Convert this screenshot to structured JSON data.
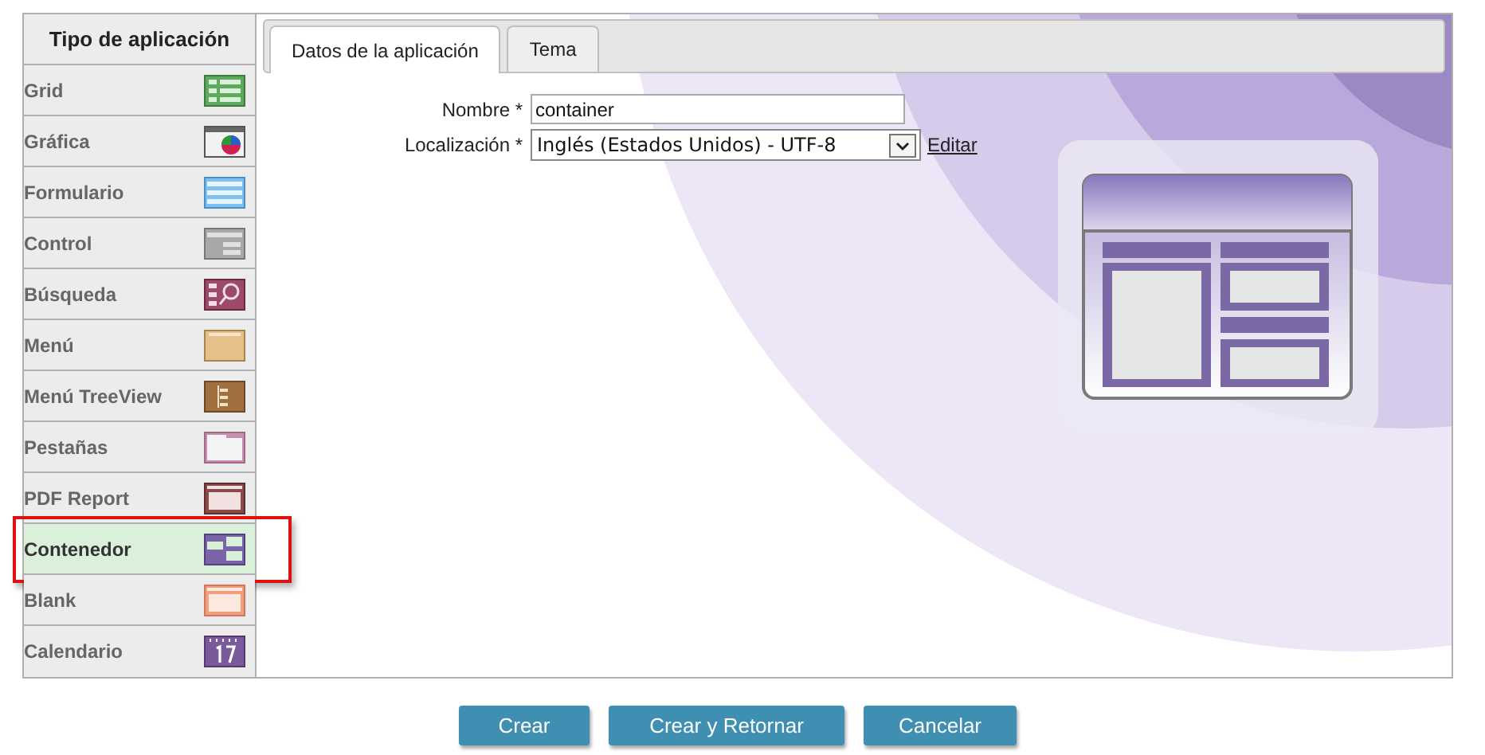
{
  "sidebar": {
    "title": "Tipo de aplicación",
    "items": [
      {
        "label": "Grid",
        "selected": false
      },
      {
        "label": "Gráfica",
        "selected": false
      },
      {
        "label": "Formulario",
        "selected": false
      },
      {
        "label": "Control",
        "selected": false
      },
      {
        "label": "Búsqueda",
        "selected": false
      },
      {
        "label": "Menú",
        "selected": false
      },
      {
        "label": "Menú TreeView",
        "selected": false
      },
      {
        "label": "Pestañas",
        "selected": false
      },
      {
        "label": "PDF Report",
        "selected": false
      },
      {
        "label": "Contenedor",
        "selected": true
      },
      {
        "label": "Blank",
        "selected": false
      },
      {
        "label": "Calendario",
        "selected": false
      }
    ]
  },
  "tabs": [
    {
      "label": "Datos de la aplicación",
      "selected": true
    },
    {
      "label": "Tema",
      "selected": false
    }
  ],
  "form": {
    "name": {
      "label": "Nombre *",
      "value": "container"
    },
    "locale": {
      "label": "Localización *",
      "value": "Inglés (Estados Unidos) - UTF-8",
      "link": "Editar"
    }
  },
  "buttons": [
    "Crear",
    "Crear y Retornar",
    "Cancelar"
  ]
}
